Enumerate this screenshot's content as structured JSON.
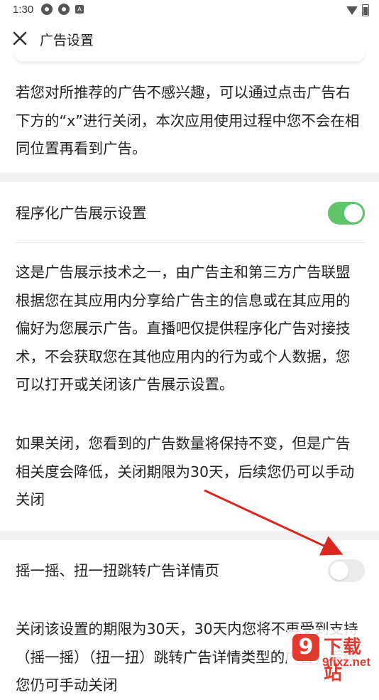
{
  "status_bar": {
    "time": "1:30",
    "left_icons": [
      "settings-gear-icon",
      "settings-gear-icon",
      "app-a-icon"
    ],
    "right_icons": [
      "wifi-icon",
      "battery-icon"
    ]
  },
  "header": {
    "title": "广告设置",
    "close_icon": "close-icon"
  },
  "sections": {
    "intro_text": "若您对所推荐的广告不感兴趣，可以通过点击广告右下方的“x”进行关闭，本次应用使用过程中您不会在相同位置再看到广告。",
    "programmatic": {
      "label": "程序化广告展示设置",
      "enabled": true,
      "description": "这是广告展示技术之一，由广告主和第三方广告联盟根据您在其应用内分享给广告主的信息或在其应用的偏好为您展示广告。直播吧仅提供程序化广告对接技术，不会获取您在其他应用内的行为或个人数据，您可以打开或关闭该广告展示设置。",
      "note": "如果关闭，您看到的广告数量将保持不变，但是广告相关度会降低，关闭期限为30天，后续您仍可以手动关闭"
    },
    "shake": {
      "label": "摇一摇、扭一扭跳转广告详情页",
      "enabled": false,
      "description": "关闭该设置的期限为30天，30天内您将不再受到支持（摇一摇）（扭一扭）跳转广告详情类型的广告，后续您仍可手动关闭"
    }
  },
  "colors": {
    "toggle_on": "#61c56e",
    "toggle_off": "#ebebeb",
    "arrow": "#d9281f",
    "section_bg": "#f2f2f2"
  },
  "watermark": {
    "badge": "9",
    "text": "下载站",
    "url": "9fixz.net"
  }
}
